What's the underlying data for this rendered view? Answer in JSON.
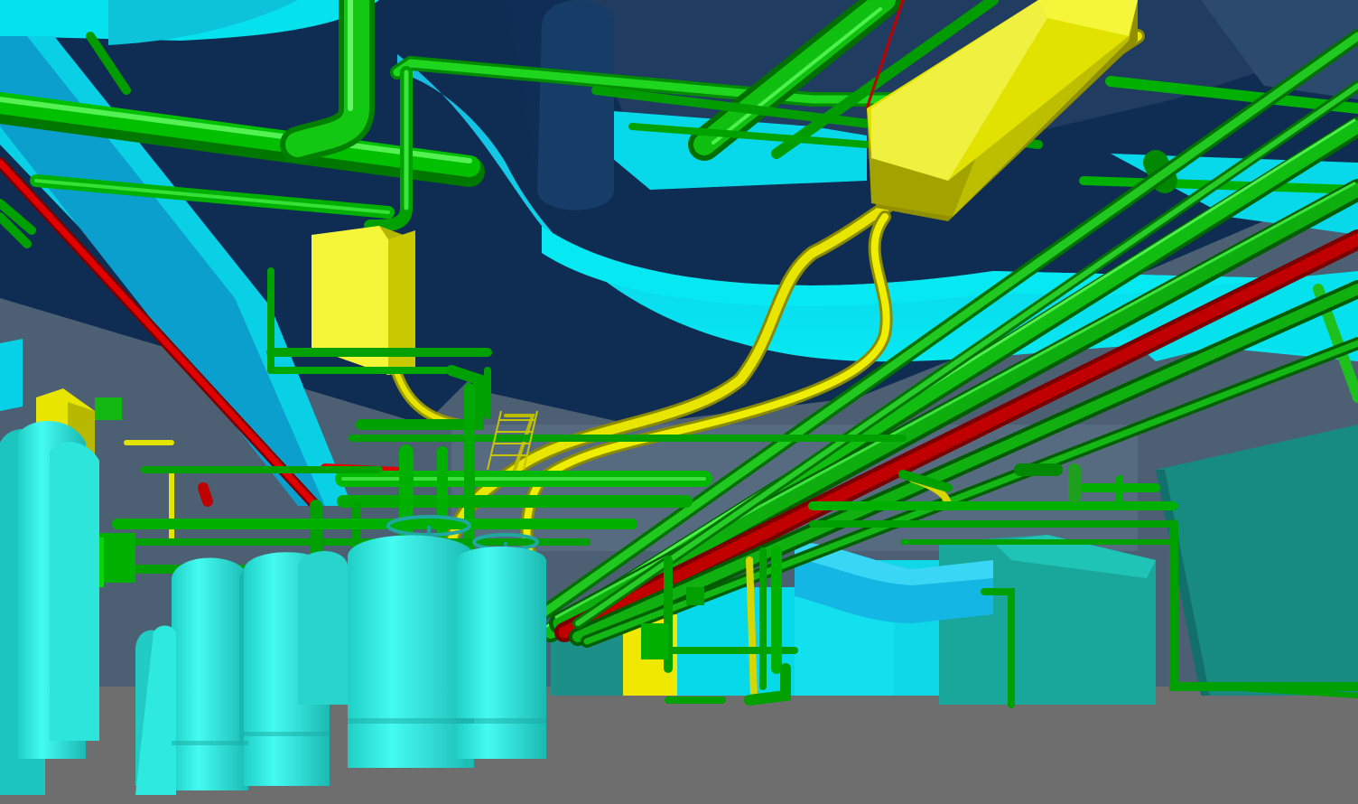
{
  "viewport": {
    "scene": "plant-room-piping-model",
    "palette": {
      "ceiling_dark": "#0f2d52",
      "duct_cyan": "#00e1ee",
      "duct_shadow": "#0e76a8",
      "pipe_green": "#00c000",
      "pipe_green_dark": "#007a00",
      "pipe_green_light": "#5cf25c",
      "pipe_yellow": "#e8e600",
      "box_yellow": "#f5f53a",
      "pipe_red": "#e00000",
      "tank_cyan": "#33f0e6",
      "teal_block": "#1a8f86",
      "floor_grey": "#6e6e6e",
      "backdrop_grey": "#4c5f73"
    }
  }
}
